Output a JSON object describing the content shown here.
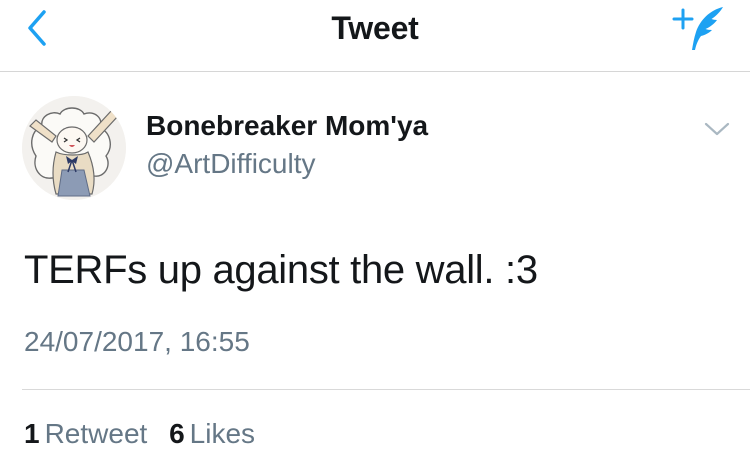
{
  "header": {
    "title": "Tweet",
    "back_icon": "chevron-left-icon",
    "compose_icon": "compose-feather-icon"
  },
  "tweet": {
    "author_name": "Bonebreaker Mom'ya",
    "author_handle": "@ArtDifficulty",
    "text": "TERFs up against the wall. :3",
    "timestamp": "24/07/2017, 16:55",
    "retweet_count": "1",
    "retweet_label": "Retweet",
    "like_count": "6",
    "like_label": "Likes"
  },
  "colors": {
    "accent": "#1da1f2",
    "secondary_text": "#657786",
    "primary_text": "#14171a"
  }
}
